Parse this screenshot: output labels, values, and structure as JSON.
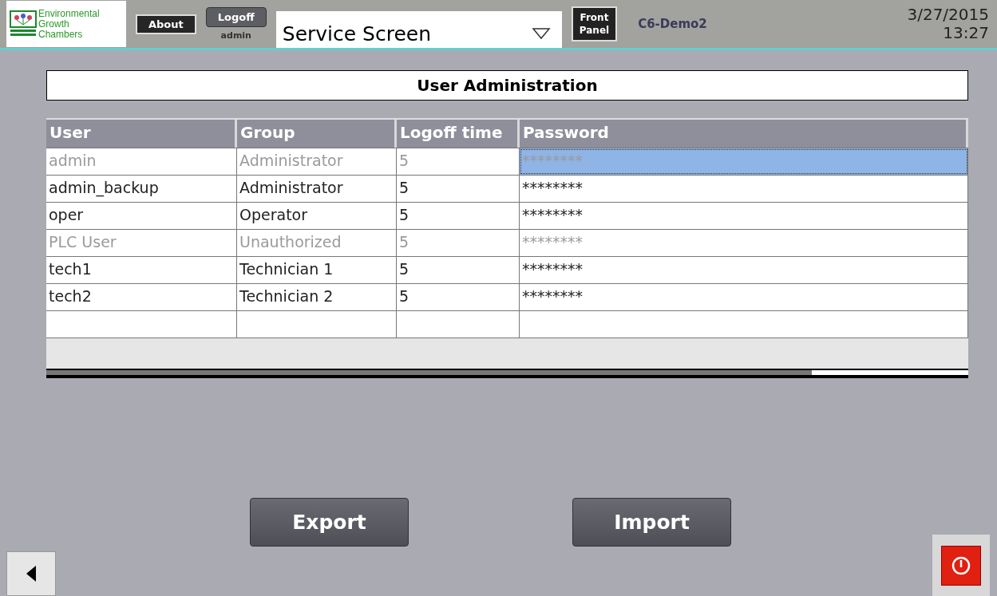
{
  "header": {
    "logo_text": [
      "Environmental",
      "Growth",
      "Chambers"
    ],
    "about": "About",
    "logoff": "Logoff",
    "user": "admin",
    "screen_select": "Service Screen",
    "front_panel": [
      "Front",
      "Panel"
    ],
    "device": "C6-Demo2",
    "date": "3/27/2015",
    "time": "13:27"
  },
  "title": "User Administration",
  "table": {
    "columns": [
      "User",
      "Group",
      "Logoff time",
      "Password"
    ],
    "rows": [
      {
        "cells": [
          "admin",
          "Administrator",
          "5",
          "********"
        ],
        "disabled": true,
        "selected": true
      },
      {
        "cells": [
          "admin_backup",
          "Administrator",
          "5",
          "********"
        ],
        "disabled": false,
        "selected": false
      },
      {
        "cells": [
          "oper",
          "Operator",
          "5",
          "********"
        ],
        "disabled": false,
        "selected": false
      },
      {
        "cells": [
          "PLC User",
          "Unauthorized",
          "5",
          "********"
        ],
        "disabled": true,
        "selected": false
      },
      {
        "cells": [
          "tech1",
          "Technician 1",
          "5",
          "********"
        ],
        "disabled": false,
        "selected": false
      },
      {
        "cells": [
          "tech2",
          "Technician 2",
          "5",
          "********"
        ],
        "disabled": false,
        "selected": false
      }
    ]
  },
  "buttons": [
    "Export",
    "Import"
  ]
}
